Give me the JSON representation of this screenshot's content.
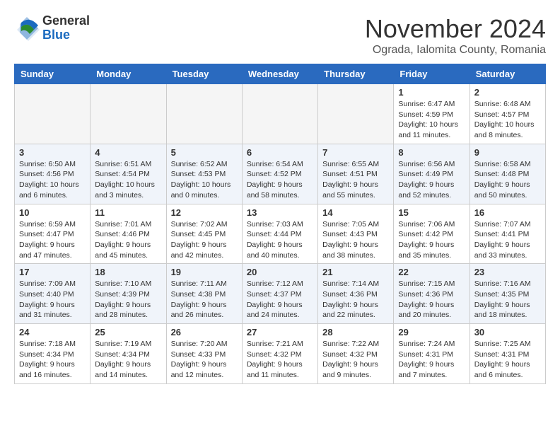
{
  "header": {
    "logo_general": "General",
    "logo_blue": "Blue",
    "month_title": "November 2024",
    "location": "Ograda, Ialomita County, Romania"
  },
  "days_of_week": [
    "Sunday",
    "Monday",
    "Tuesday",
    "Wednesday",
    "Thursday",
    "Friday",
    "Saturday"
  ],
  "weeks": [
    [
      {
        "day": "",
        "info": ""
      },
      {
        "day": "",
        "info": ""
      },
      {
        "day": "",
        "info": ""
      },
      {
        "day": "",
        "info": ""
      },
      {
        "day": "",
        "info": ""
      },
      {
        "day": "1",
        "info": "Sunrise: 6:47 AM\nSunset: 4:59 PM\nDaylight: 10 hours and 11 minutes."
      },
      {
        "day": "2",
        "info": "Sunrise: 6:48 AM\nSunset: 4:57 PM\nDaylight: 10 hours and 8 minutes."
      }
    ],
    [
      {
        "day": "3",
        "info": "Sunrise: 6:50 AM\nSunset: 4:56 PM\nDaylight: 10 hours and 6 minutes."
      },
      {
        "day": "4",
        "info": "Sunrise: 6:51 AM\nSunset: 4:54 PM\nDaylight: 10 hours and 3 minutes."
      },
      {
        "day": "5",
        "info": "Sunrise: 6:52 AM\nSunset: 4:53 PM\nDaylight: 10 hours and 0 minutes."
      },
      {
        "day": "6",
        "info": "Sunrise: 6:54 AM\nSunset: 4:52 PM\nDaylight: 9 hours and 58 minutes."
      },
      {
        "day": "7",
        "info": "Sunrise: 6:55 AM\nSunset: 4:51 PM\nDaylight: 9 hours and 55 minutes."
      },
      {
        "day": "8",
        "info": "Sunrise: 6:56 AM\nSunset: 4:49 PM\nDaylight: 9 hours and 52 minutes."
      },
      {
        "day": "9",
        "info": "Sunrise: 6:58 AM\nSunset: 4:48 PM\nDaylight: 9 hours and 50 minutes."
      }
    ],
    [
      {
        "day": "10",
        "info": "Sunrise: 6:59 AM\nSunset: 4:47 PM\nDaylight: 9 hours and 47 minutes."
      },
      {
        "day": "11",
        "info": "Sunrise: 7:01 AM\nSunset: 4:46 PM\nDaylight: 9 hours and 45 minutes."
      },
      {
        "day": "12",
        "info": "Sunrise: 7:02 AM\nSunset: 4:45 PM\nDaylight: 9 hours and 42 minutes."
      },
      {
        "day": "13",
        "info": "Sunrise: 7:03 AM\nSunset: 4:44 PM\nDaylight: 9 hours and 40 minutes."
      },
      {
        "day": "14",
        "info": "Sunrise: 7:05 AM\nSunset: 4:43 PM\nDaylight: 9 hours and 38 minutes."
      },
      {
        "day": "15",
        "info": "Sunrise: 7:06 AM\nSunset: 4:42 PM\nDaylight: 9 hours and 35 minutes."
      },
      {
        "day": "16",
        "info": "Sunrise: 7:07 AM\nSunset: 4:41 PM\nDaylight: 9 hours and 33 minutes."
      }
    ],
    [
      {
        "day": "17",
        "info": "Sunrise: 7:09 AM\nSunset: 4:40 PM\nDaylight: 9 hours and 31 minutes."
      },
      {
        "day": "18",
        "info": "Sunrise: 7:10 AM\nSunset: 4:39 PM\nDaylight: 9 hours and 28 minutes."
      },
      {
        "day": "19",
        "info": "Sunrise: 7:11 AM\nSunset: 4:38 PM\nDaylight: 9 hours and 26 minutes."
      },
      {
        "day": "20",
        "info": "Sunrise: 7:12 AM\nSunset: 4:37 PM\nDaylight: 9 hours and 24 minutes."
      },
      {
        "day": "21",
        "info": "Sunrise: 7:14 AM\nSunset: 4:36 PM\nDaylight: 9 hours and 22 minutes."
      },
      {
        "day": "22",
        "info": "Sunrise: 7:15 AM\nSunset: 4:36 PM\nDaylight: 9 hours and 20 minutes."
      },
      {
        "day": "23",
        "info": "Sunrise: 7:16 AM\nSunset: 4:35 PM\nDaylight: 9 hours and 18 minutes."
      }
    ],
    [
      {
        "day": "24",
        "info": "Sunrise: 7:18 AM\nSunset: 4:34 PM\nDaylight: 9 hours and 16 minutes."
      },
      {
        "day": "25",
        "info": "Sunrise: 7:19 AM\nSunset: 4:34 PM\nDaylight: 9 hours and 14 minutes."
      },
      {
        "day": "26",
        "info": "Sunrise: 7:20 AM\nSunset: 4:33 PM\nDaylight: 9 hours and 12 minutes."
      },
      {
        "day": "27",
        "info": "Sunrise: 7:21 AM\nSunset: 4:32 PM\nDaylight: 9 hours and 11 minutes."
      },
      {
        "day": "28",
        "info": "Sunrise: 7:22 AM\nSunset: 4:32 PM\nDaylight: 9 hours and 9 minutes."
      },
      {
        "day": "29",
        "info": "Sunrise: 7:24 AM\nSunset: 4:31 PM\nDaylight: 9 hours and 7 minutes."
      },
      {
        "day": "30",
        "info": "Sunrise: 7:25 AM\nSunset: 4:31 PM\nDaylight: 9 hours and 6 minutes."
      }
    ]
  ]
}
